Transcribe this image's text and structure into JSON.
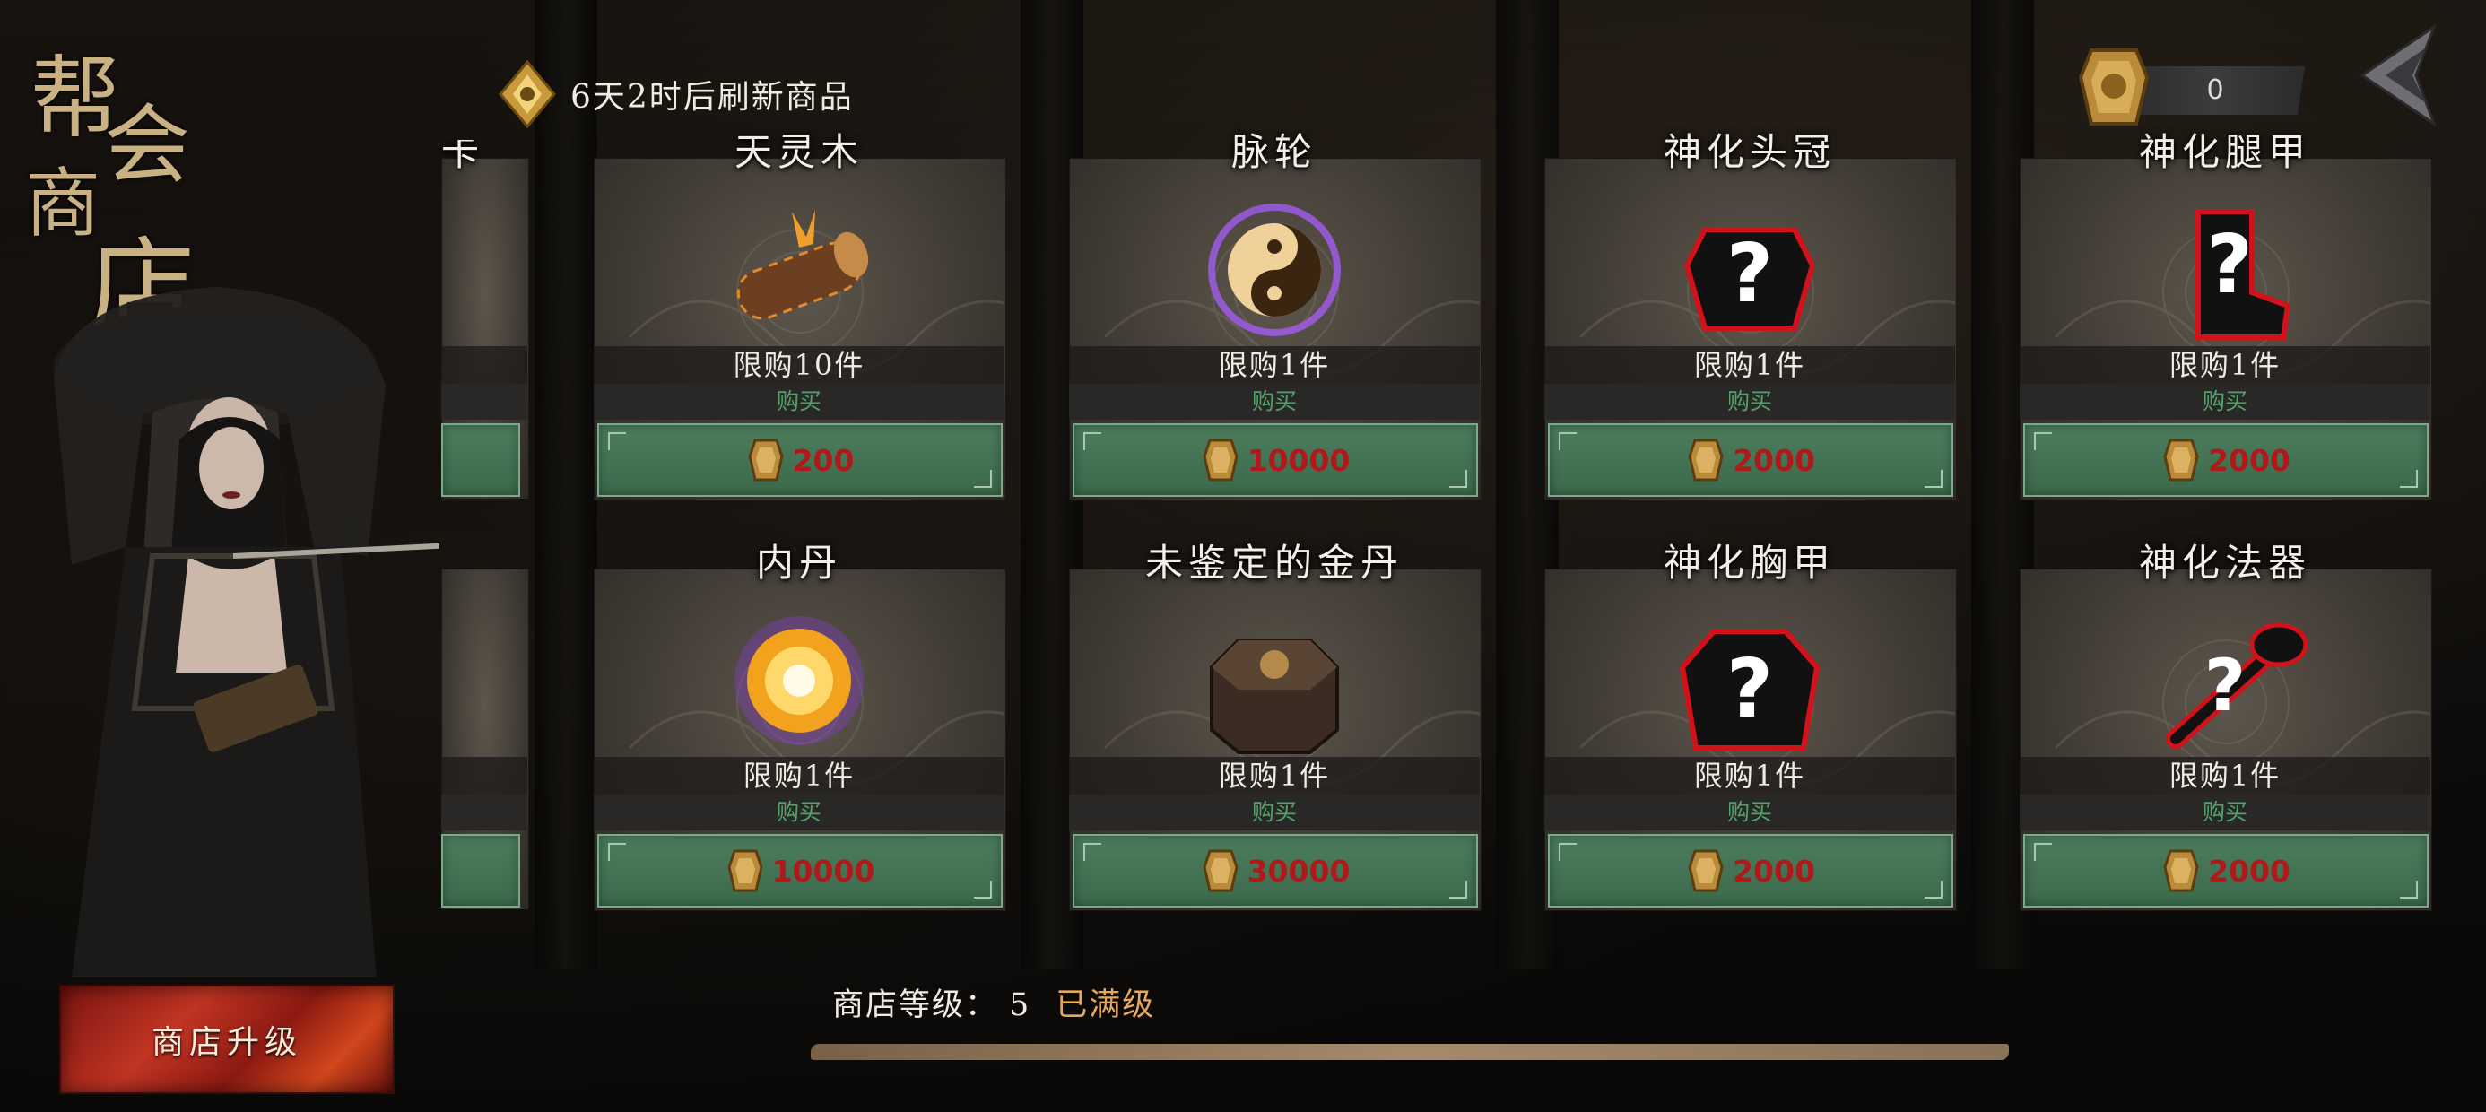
{
  "shop": {
    "title_chars": [
      "帮",
      "会",
      "商",
      "店"
    ],
    "refresh_text": "6天2时后刷新商品",
    "currency_value": "0",
    "upgrade_label": "商店升级",
    "level_label": "商店等级：",
    "level_value": "5",
    "level_status": "已满级",
    "level_progress": 1.0
  },
  "partial_card": {
    "title_fragment": "卡"
  },
  "items": [
    {
      "name": "天灵木",
      "limit": "限购10件",
      "buy": "购买",
      "price": "200",
      "icon": "log-icon"
    },
    {
      "name": "脉轮",
      "limit": "限购1件",
      "buy": "购买",
      "price": "10000",
      "icon": "yin-yang-orb-icon"
    },
    {
      "name": "神化头冠",
      "limit": "限购1件",
      "buy": "购买",
      "price": "2000",
      "icon": "mystery-helmet-icon"
    },
    {
      "name": "神化腿甲",
      "limit": "限购1件",
      "buy": "购买",
      "price": "2000",
      "icon": "mystery-boot-icon"
    },
    {
      "name": "内丹",
      "limit": "限购1件",
      "buy": "购买",
      "price": "10000",
      "icon": "glowing-orb-icon"
    },
    {
      "name": "未鉴定的金丹",
      "limit": "限购1件",
      "buy": "购买",
      "price": "30000",
      "icon": "treasure-box-icon"
    },
    {
      "name": "神化胸甲",
      "limit": "限购1件",
      "buy": "购买",
      "price": "2000",
      "icon": "mystery-chest-armor-icon"
    },
    {
      "name": "神化法器",
      "limit": "限购1件",
      "buy": "购买",
      "price": "2000",
      "icon": "mystery-weapon-icon"
    }
  ],
  "colors": {
    "buy_green": "#4fa46a",
    "price_red": "#b0191a",
    "button_green": "#4c7d5d",
    "max_level_gold": "#e7a75c"
  }
}
